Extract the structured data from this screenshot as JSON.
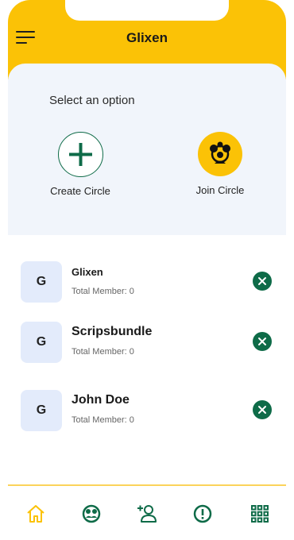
{
  "app": {
    "title": "Glixen"
  },
  "options": {
    "heading": "Select an option",
    "create_label": "Create Circle",
    "join_label": "Join Circle"
  },
  "circles": [
    {
      "initial": "G",
      "name": "Glixen",
      "members": "Total Member: 0"
    },
    {
      "initial": "G",
      "name": "Scripsbundle",
      "members": "Total Member: 0"
    },
    {
      "initial": "G",
      "name": "John Doe",
      "members": "Total Member: 0"
    }
  ],
  "nav": {
    "items": [
      "home-icon",
      "circle-group-icon",
      "add-user-icon",
      "alert-icon",
      "grid-menu-icon"
    ],
    "active": "home-icon"
  },
  "colors": {
    "brand_yellow": "#fbc206",
    "brand_green": "#0e6b48",
    "panel_bg": "#f1f5fb",
    "avatar_bg": "#e3ebfb"
  }
}
